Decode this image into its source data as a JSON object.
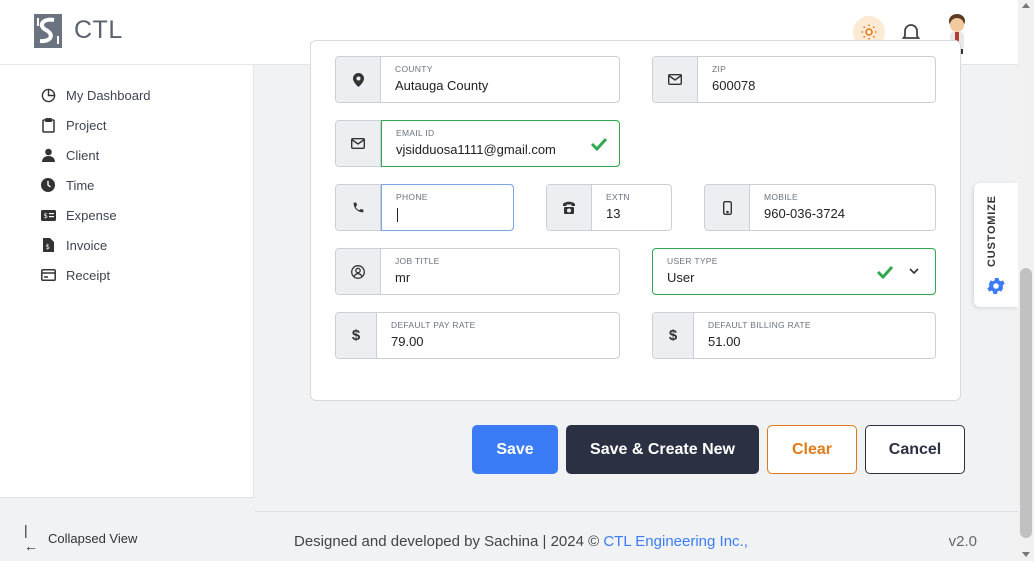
{
  "header": {
    "logo_text": "CTL",
    "icons": [
      "logo-mark",
      "sun-icon",
      "bell-icon",
      "avatar"
    ]
  },
  "sidebar": {
    "items": [
      {
        "label": "My Dashboard",
        "icon": "pie-chart-icon"
      },
      {
        "label": "Project",
        "icon": "clipboard-icon"
      },
      {
        "label": "Client",
        "icon": "user-icon"
      },
      {
        "label": "Time",
        "icon": "clock-icon"
      },
      {
        "label": "Expense",
        "icon": "money-icon"
      },
      {
        "label": "Invoice",
        "icon": "invoice-icon"
      },
      {
        "label": "Receipt",
        "icon": "receipt-icon"
      }
    ],
    "collapse_label": "Collapsed View"
  },
  "form": {
    "county": {
      "label": "COUNTY",
      "value": "Autauga County",
      "icon": "map-pin-icon"
    },
    "zip": {
      "label": "ZIP",
      "value": "600078",
      "icon": "envelope-icon"
    },
    "email": {
      "label": "EMAIL ID",
      "value": "vjsidduosa1111@gmail.com",
      "icon": "envelope-icon"
    },
    "phone": {
      "label": "PHONE",
      "value": "",
      "icon": "phone-icon"
    },
    "extn": {
      "label": "EXTN",
      "value": "13",
      "icon": "telephone-icon"
    },
    "mobile": {
      "label": "MOBILE",
      "value": "960-036-3724",
      "icon": "mobile-icon"
    },
    "job_title": {
      "label": "JOB TITLE",
      "value": "mr",
      "icon": "user-circle-icon"
    },
    "user_type": {
      "label": "USER TYPE",
      "value": "User"
    },
    "pay_rate": {
      "label": "DEFAULT PAY RATE",
      "value": "79.00",
      "prefix": "$"
    },
    "billing_rate": {
      "label": "DEFAULT BILLING RATE",
      "value": "51.00",
      "prefix": "$"
    }
  },
  "buttons": {
    "save": "Save",
    "save_new": "Save & Create New",
    "clear": "Clear",
    "cancel": "Cancel"
  },
  "customize": {
    "label": "CUSTOMIZE"
  },
  "footer": {
    "text": "Designed and developed by Sachina | 2024 © ",
    "link": "CTL Engineering Inc.,",
    "version": "v2.0"
  },
  "colors": {
    "primary": "#3b7cf6",
    "dark": "#2b3142",
    "accent": "#e07b18",
    "valid": "#2fa84f"
  }
}
